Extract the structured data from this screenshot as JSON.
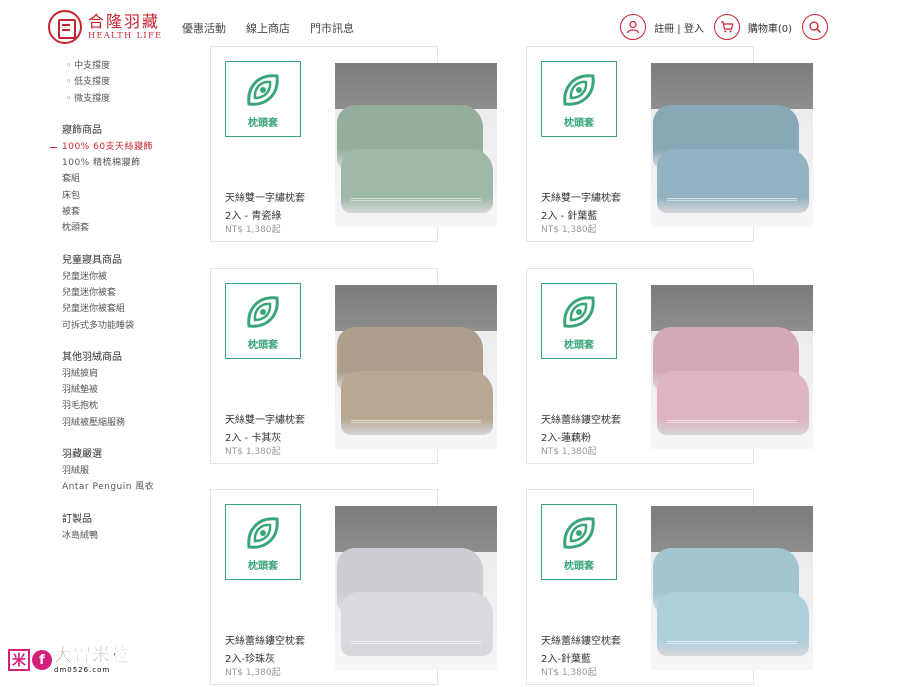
{
  "brand": {
    "name_cn": "合隆羽藏",
    "name_en": "HEALTH LIFE"
  },
  "nav": {
    "items": [
      "優惠活動",
      "線上商店",
      "門市訊息"
    ]
  },
  "header": {
    "auth_label": "註冊 | 登入",
    "cart_label": "購物車(0)"
  },
  "sidebar": {
    "top_items": [
      "中支撐度",
      "低支撐度",
      "微支撐度"
    ],
    "groups": [
      {
        "title": "寢飾商品",
        "items": [
          "100% 60支天絲寢飾",
          "100% 精梳棉寢飾",
          "套組",
          "床包",
          "被套",
          "枕頭套"
        ]
      },
      {
        "title": "兒童寢具商品",
        "items": [
          "兒童迷你被",
          "兒童迷你被套",
          "兒童迷你被套組",
          "可拆式多功能睡袋"
        ]
      },
      {
        "title": "其他羽絨商品",
        "items": [
          "羽絨披肩",
          "羽絨墊被",
          "羽毛抱枕",
          "羽絨被壓縮服務"
        ]
      },
      {
        "title": "羽藏嚴選",
        "items": [
          "羽絨服",
          "Antar Penguin 風衣"
        ]
      },
      {
        "title": "訂製品",
        "items": [
          "冰島絨鴨"
        ]
      }
    ]
  },
  "badge_label": "枕頭套",
  "products": [
    {
      "name": "天絲雙一字繡枕套",
      "variant": "2入 - 青瓷綠",
      "price": "NT$ 1,380起",
      "color": "#9bb5a2"
    },
    {
      "name": "天絲雙一字繡枕套",
      "variant": "2入 - 針葉藍",
      "price": "NT$ 1,380起",
      "color": "#8fafbd"
    },
    {
      "name": "天絲雙一字繡枕套",
      "variant": "2入 - 卡其灰",
      "price": "NT$ 1,380起",
      "color": "#b3a590"
    },
    {
      "name": "天絲蕾絲鏤空枕套",
      "variant": "2入-蓮藕粉",
      "price": "NT$ 1,380起",
      "color": "#dbb0bd"
    },
    {
      "name": "天絲蕾絲鏤空枕套",
      "variant": "2入-珍珠灰",
      "price": "NT$ 1,380起",
      "color": "#d6d5dc"
    },
    {
      "name": "天絲蕾絲鏤空枕套",
      "variant": "2入-針葉藍",
      "price": "NT$ 1,380起",
      "color": "#a9cdd9"
    }
  ],
  "watermark": {
    "box_char": "米",
    "f_char": "f",
    "text_cn": "大胃米粒",
    "url": "dm0526.com"
  },
  "colors": {
    "accent": "#c8242f",
    "badge_green": "#3aa57a"
  }
}
